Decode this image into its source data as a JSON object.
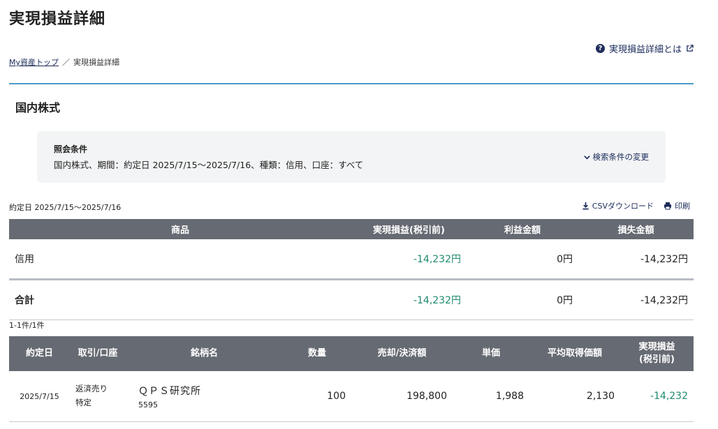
{
  "page": {
    "title": "実現損益詳細",
    "help_link": "実現損益詳細とは"
  },
  "breadcrumb": {
    "home": "My資産トップ",
    "separator": "／",
    "current": "実現損益詳細"
  },
  "section": {
    "title": "国内株式"
  },
  "conditions": {
    "label": "照会条件",
    "text": "国内株式、期間：約定日 2025/7/15〜2025/7/16、種類：信用、口座：すべて",
    "change_label": "検索条件の変更"
  },
  "period_label": "約定日 2025/7/15〜2025/7/16",
  "actions": {
    "csv": "CSVダウンロード",
    "print": "印刷"
  },
  "summary": {
    "headers": [
      "商品",
      "実現損益(税引前)",
      "利益金額",
      "損失金額"
    ],
    "rows": [
      {
        "product": "信用",
        "realized": "-14,232円",
        "profit": "0円",
        "loss": "-14,232円"
      }
    ],
    "total": {
      "label": "合計",
      "realized": "-14,232円",
      "profit": "0円",
      "loss": "-14,232円"
    }
  },
  "count_label": "1-1件/1件",
  "detail": {
    "headers": {
      "date": "約定日",
      "trade": "取引/口座",
      "name": "銘柄名",
      "qty": "数量",
      "amount": "売却/決済額",
      "price": "単価",
      "avg": "平均取得価額",
      "pl_line1": "実現損益",
      "pl_line2": "(税引前)"
    },
    "rows": [
      {
        "date": "2025/7/15",
        "trade": "返済売り",
        "account": "特定",
        "name": "ＱＰＳ研究所",
        "code": "5595",
        "qty": "100",
        "amount": "198,800",
        "price": "1,988",
        "avg": "2,130",
        "pl": "-14,232"
      }
    ]
  },
  "colors": {
    "accent_line": "#4a9cc8",
    "header_bg": "#666a72",
    "negative_value": "#1e8a70",
    "link": "#1a2a5a"
  },
  "icons": [
    "help-icon",
    "external-link-icon",
    "chevron-down-icon",
    "download-icon",
    "print-icon"
  ]
}
